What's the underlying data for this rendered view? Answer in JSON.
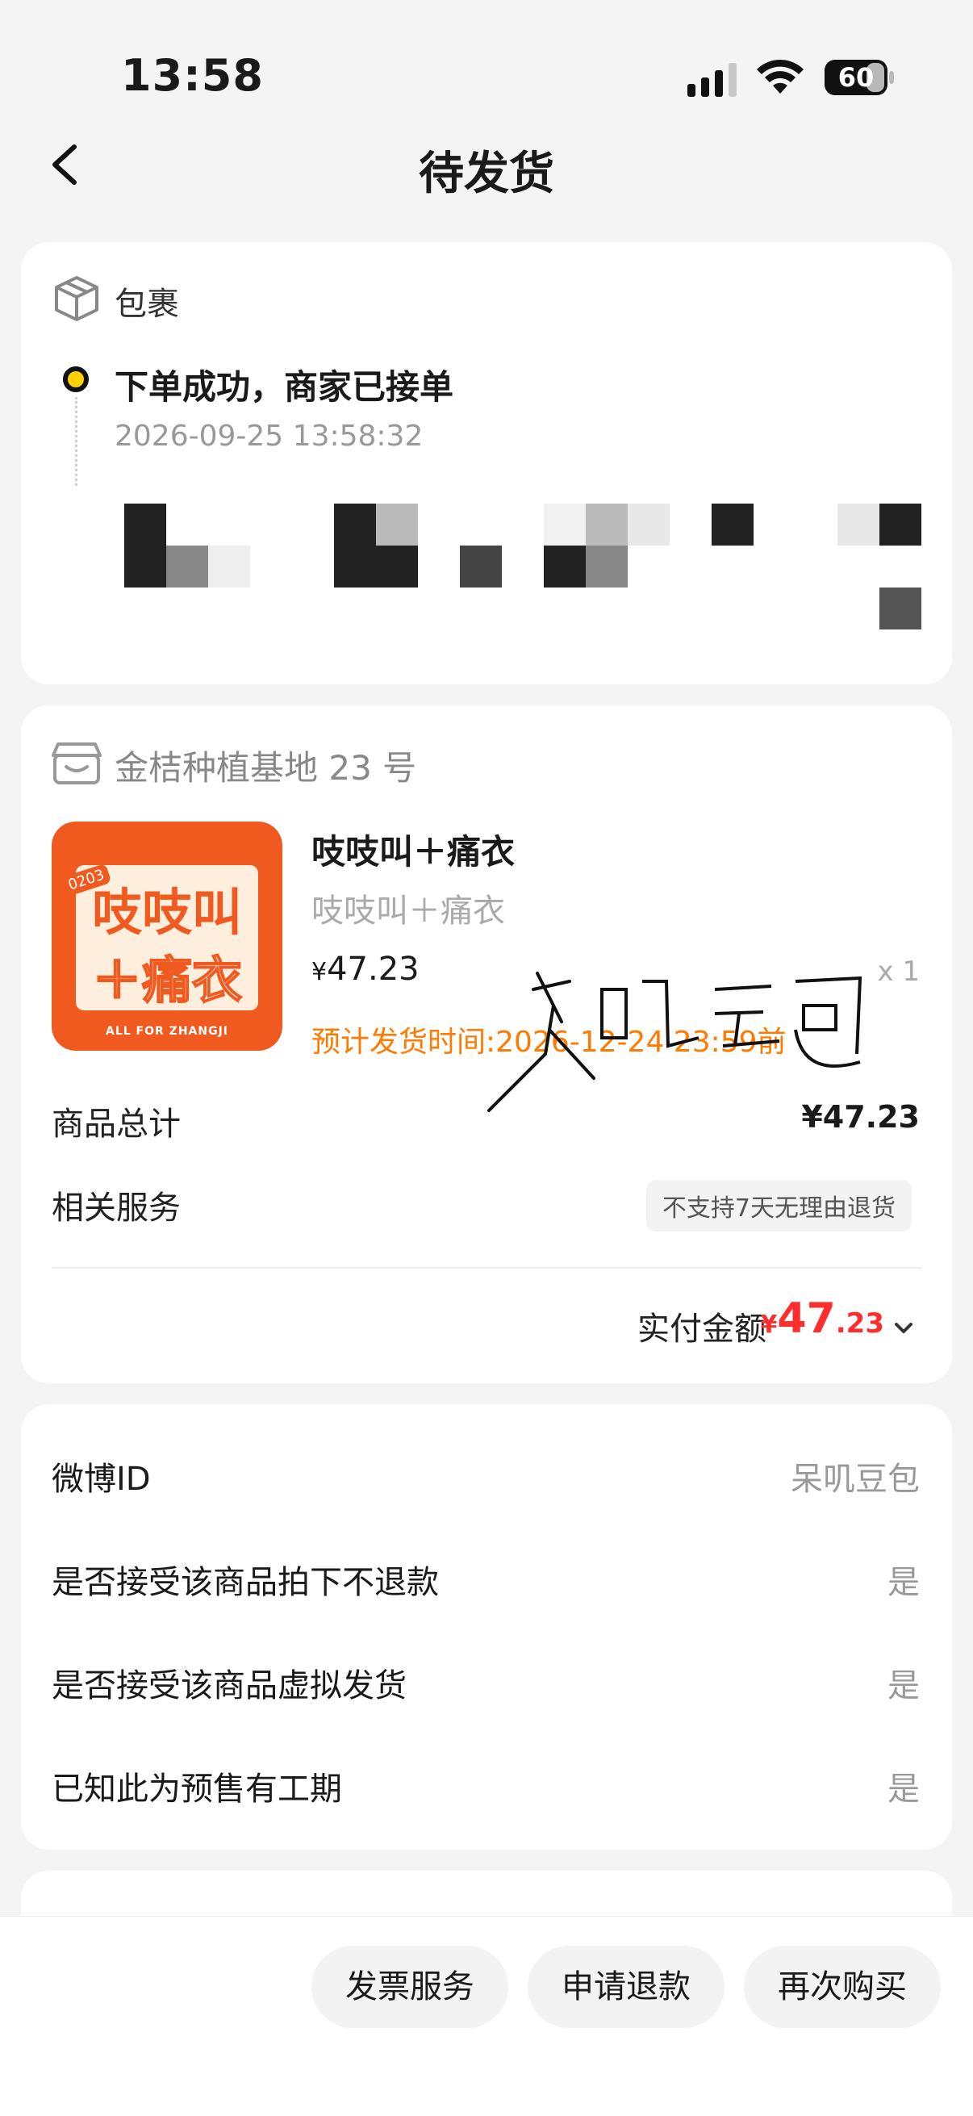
{
  "status_bar": {
    "time": "13:58",
    "battery": "60"
  },
  "nav": {
    "title": "待发货"
  },
  "parcel": {
    "label": "包裹",
    "status": "下单成功，商家已接单",
    "timestamp": "2026-09-25 13:58:32"
  },
  "order": {
    "shop_name": "金桔种植基地 23 号",
    "thumbnail": {
      "tag": "0203",
      "line1": "吱吱叫",
      "line2": "＋痛衣",
      "exclaim": "!!",
      "footer": "ALL FOR ZHANGJI"
    },
    "product_name": "吱吱叫＋痛衣",
    "product_variant": "吱吱叫＋痛衣",
    "price_currency": "¥",
    "price_value": "47.23",
    "quantity": "x 1",
    "ship_time": "预计发货时间:2026-12-24 23:59前",
    "total_label": "商品总计",
    "total_value": "¥47.23",
    "service_label": "相关服务",
    "service_tag": "不支持7天无理由退货",
    "paid_label": "实付金额",
    "paid_currency": "¥",
    "paid_int": "47",
    "paid_dec": ".23",
    "signature_text": "呆叽豆包"
  },
  "info": [
    {
      "label": "微博ID",
      "value": "呆叽豆包"
    },
    {
      "label": "是否接受该商品拍下不退款",
      "value": "是"
    },
    {
      "label": "是否接受该商品虚拟发货",
      "value": "是"
    },
    {
      "label": "已知此为预售有工期",
      "value": "是"
    }
  ],
  "actions": {
    "invoice": "发票服务",
    "refund": "申请退款",
    "rebuy": "再次购买"
  },
  "colors": {
    "accent": "#ff7a00",
    "price_red": "#ff2d2d",
    "timeline_dot": "#ffd100",
    "thumb_orange": "#f15a1f"
  }
}
